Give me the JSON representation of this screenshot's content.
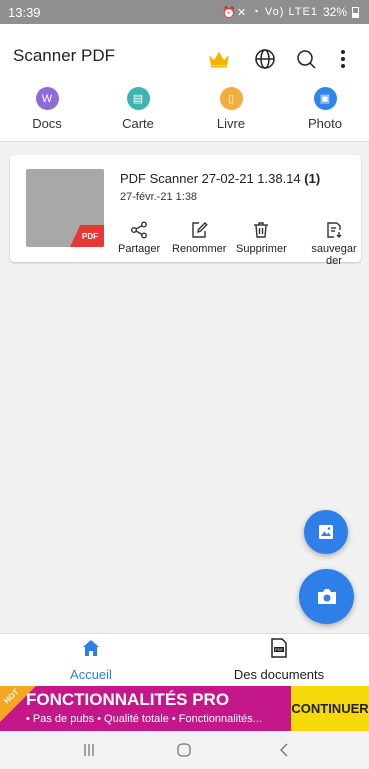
{
  "status": {
    "time": "13:39",
    "battery": "32%",
    "signal_text": "Vo) LTE1"
  },
  "app": {
    "title": "Scanner PDF",
    "colors": {
      "crown": "#f5b400",
      "accent": "#2f7fe8"
    }
  },
  "categories": [
    {
      "label": "Docs",
      "icon": "docs-icon",
      "color": "#8e6bd8",
      "glyph": "W"
    },
    {
      "label": "Carte",
      "icon": "card-icon",
      "color": "#3fb3b0",
      "glyph": "▤"
    },
    {
      "label": "Livre",
      "icon": "book-icon",
      "color": "#f3ad3b",
      "glyph": "▯"
    },
    {
      "label": "Photo",
      "icon": "photo-icon",
      "color": "#2f86e8",
      "glyph": "▣"
    }
  ],
  "document": {
    "title_main": "PDF Scanner 27-02-21 1.38.14",
    "title_count": "(1)",
    "date": "27-févr.-21 1:38",
    "pdf_tag": "PDF",
    "actions": {
      "share": "Partager",
      "rename": "Renommer",
      "delete": "Supprimer",
      "backup": "sauvegarder"
    }
  },
  "bottom_nav": {
    "home": "Accueil",
    "documents": "Des documents",
    "active_color": "#2f7fe8"
  },
  "promo": {
    "hot": "HOT",
    "title": "FONCTIONNALITÉS PRO",
    "subtitle": "• Pas de pubs • Qualité totale • Fonctionnalités...",
    "button": "CONTINUER"
  }
}
